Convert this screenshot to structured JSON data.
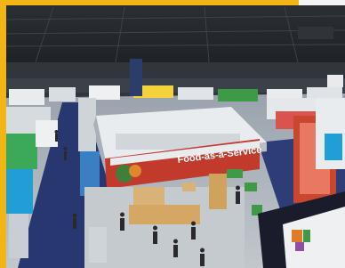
{
  "photo": {
    "subject": "",
    "accent_color": "#f2b614"
  },
  "signs": {
    "food_banner": "Food-as-a-Service",
    "ceiling_sign": "",
    "corner_logo": ""
  },
  "colors": {
    "floor_blue": "#28376f",
    "floor_grey": "#b9bfc6",
    "ceiling": "#23272b",
    "booth_red": "#c23a2c",
    "booth_green": "#3f9a48",
    "booth_white": "#e9ecef"
  }
}
